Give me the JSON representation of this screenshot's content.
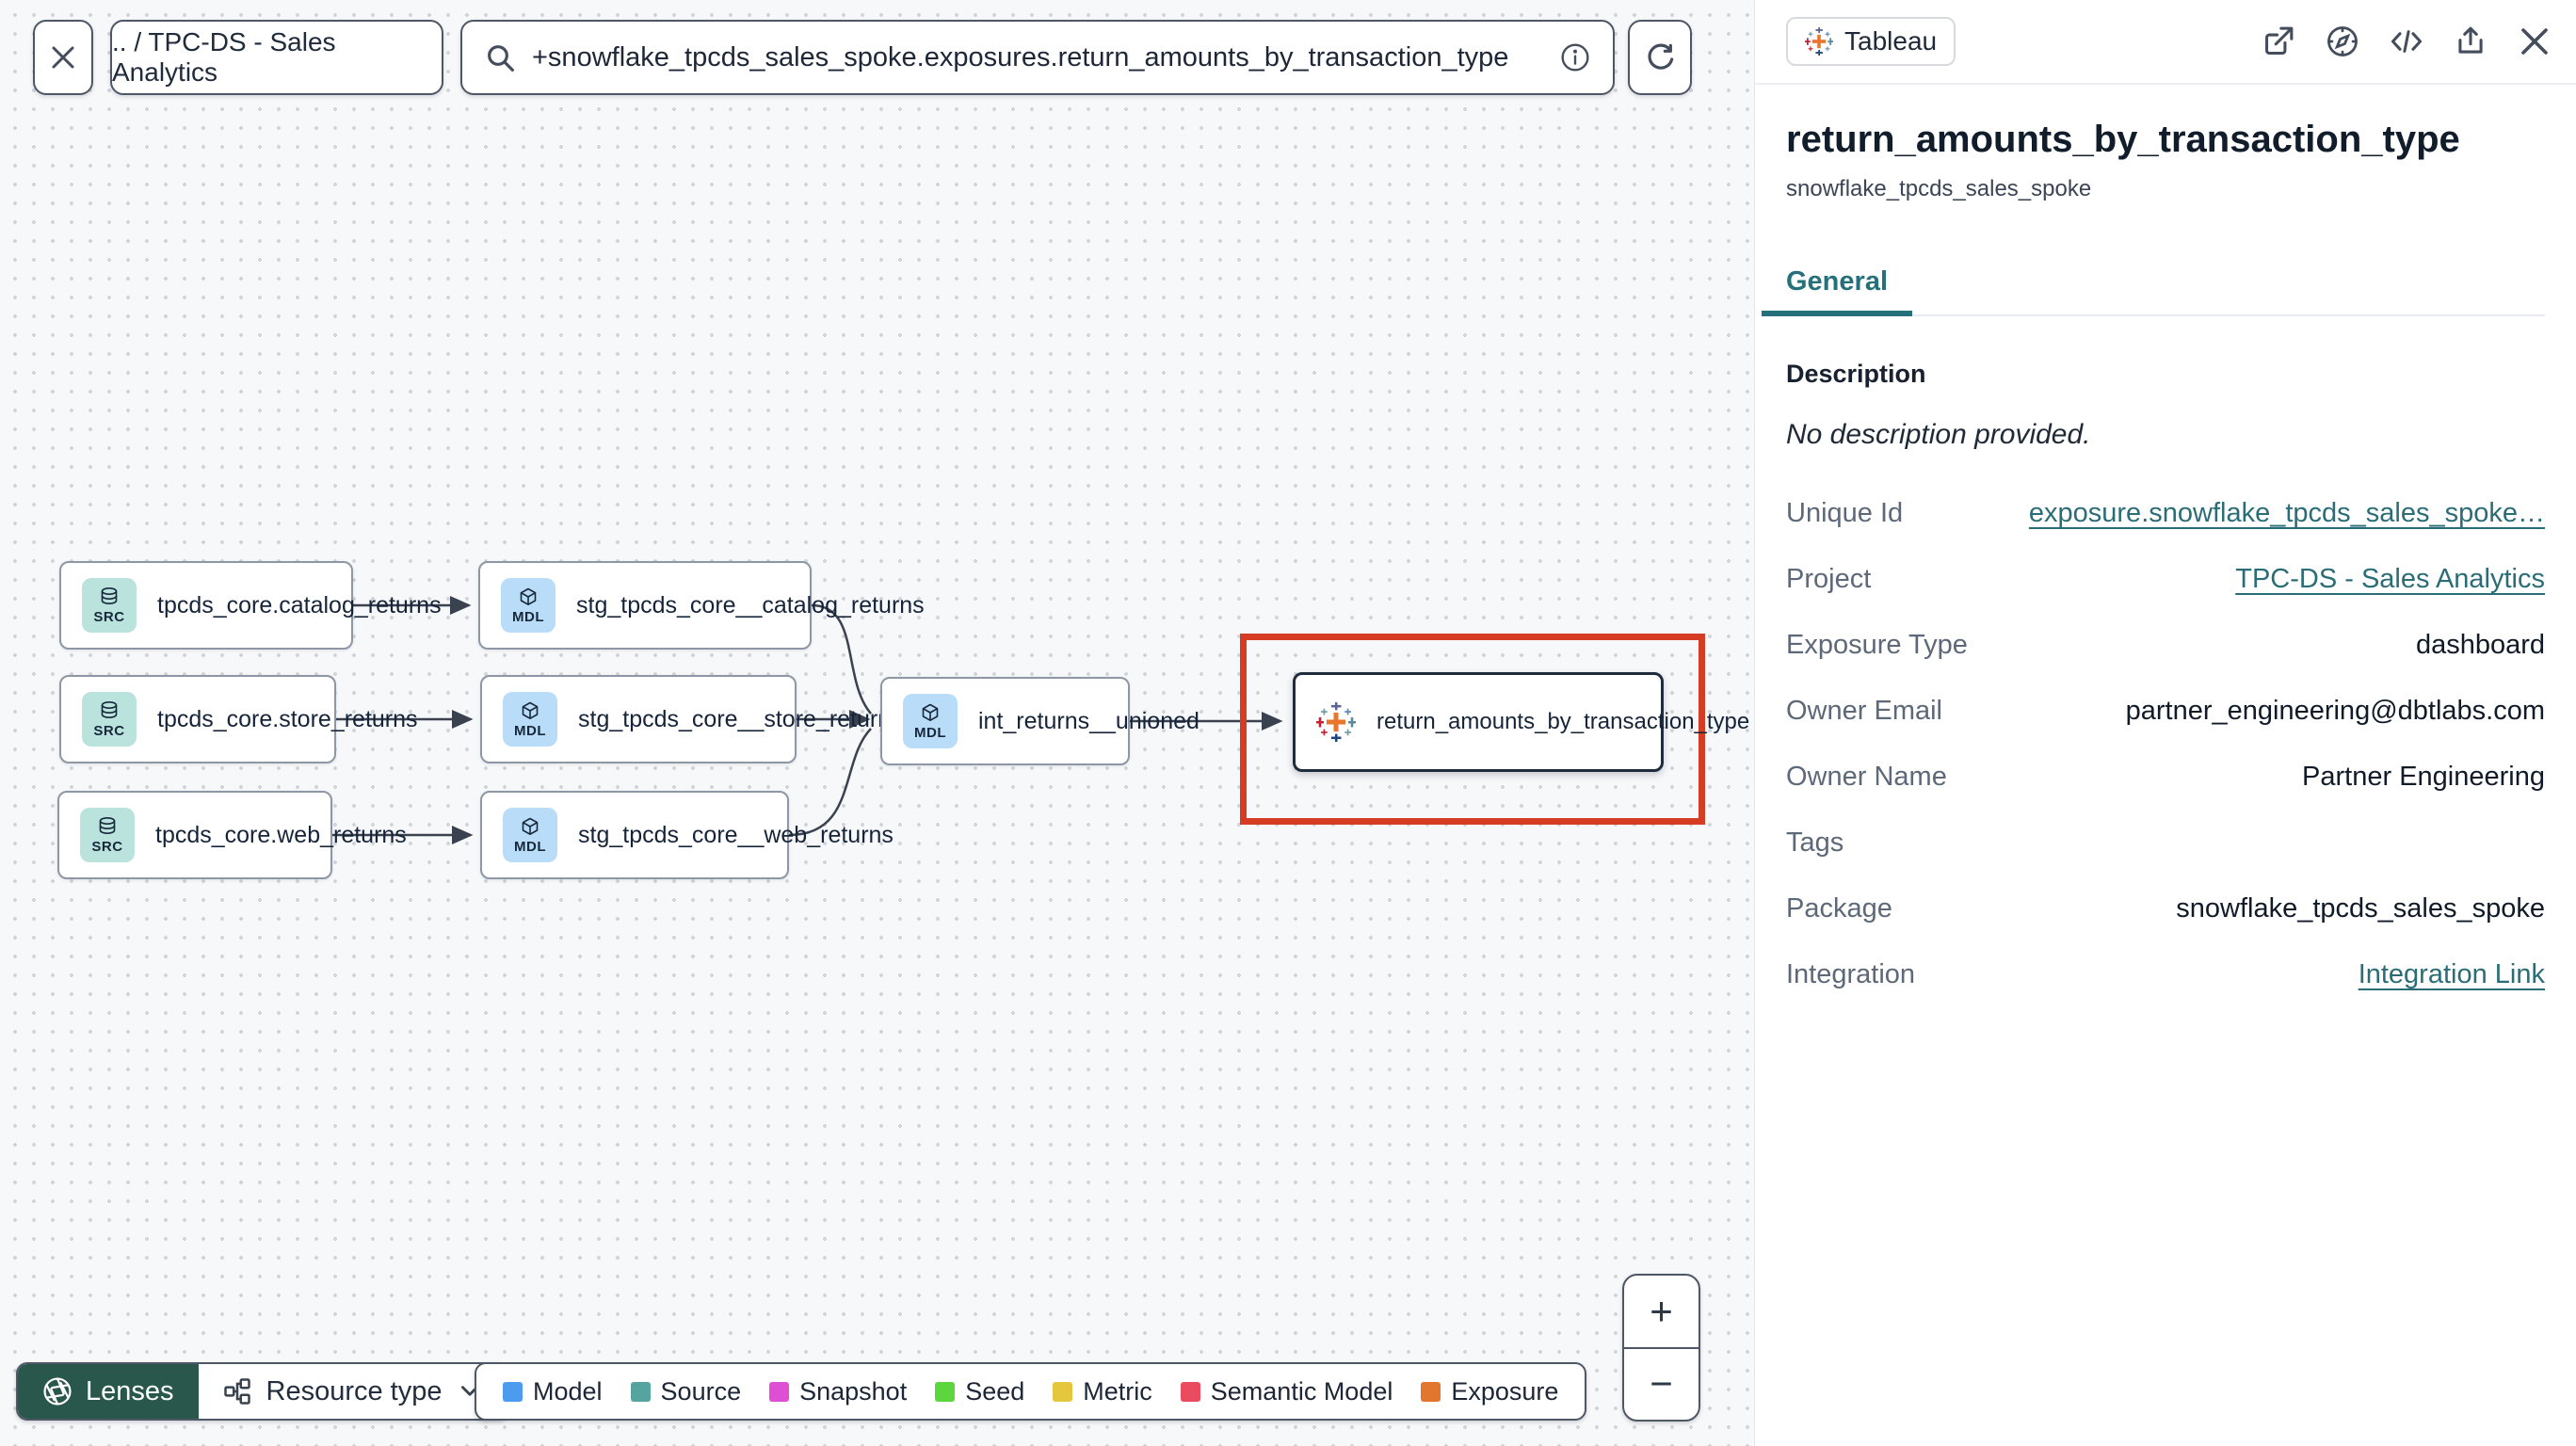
{
  "topbar": {
    "breadcrumb": ".. / TPC-DS - Sales Analytics",
    "search_value": "+snowflake_tpcds_sales_spoke.exposures.return_amounts_by_transaction_type"
  },
  "graph": {
    "nodes": [
      {
        "badge": "SRC",
        "label": "tpcds_core.catalog_returns",
        "type": "source"
      },
      {
        "badge": "SRC",
        "label": "tpcds_core.store_returns",
        "type": "source"
      },
      {
        "badge": "SRC",
        "label": "tpcds_core.web_returns",
        "type": "source"
      },
      {
        "badge": "MDL",
        "label": "stg_tpcds_core__catalog_returns",
        "type": "model"
      },
      {
        "badge": "MDL",
        "label": "stg_tpcds_core__store_returns",
        "type": "model"
      },
      {
        "badge": "MDL",
        "label": "stg_tpcds_core__web_returns",
        "type": "model"
      },
      {
        "badge": "MDL",
        "label": "int_returns__unioned",
        "type": "model"
      },
      {
        "badge": "",
        "label": "return_amounts_by_transaction_type",
        "type": "exposure"
      }
    ]
  },
  "toolbar": {
    "lenses_label": "Lenses",
    "resource_type_label": "Resource type"
  },
  "legend": {
    "items": [
      {
        "label": "Model",
        "color": "#4d9bf0"
      },
      {
        "label": "Source",
        "color": "#55a49f"
      },
      {
        "label": "Snapshot",
        "color": "#df4fd3"
      },
      {
        "label": "Seed",
        "color": "#5cd63d"
      },
      {
        "label": "Metric",
        "color": "#e5c73d"
      },
      {
        "label": "Semantic Model",
        "color": "#ea4b5f"
      },
      {
        "label": "Exposure",
        "color": "#e2762e"
      }
    ]
  },
  "zoom_controls": {
    "zoom_in": "+",
    "zoom_out": "−"
  },
  "panel": {
    "integration_badge": "Tableau",
    "title": "return_amounts_by_transaction_type",
    "subtitle": "snowflake_tpcds_sales_spoke",
    "tabs": [
      {
        "label": "General",
        "active": true
      }
    ],
    "description_heading": "Description",
    "description_empty": "No description provided.",
    "fields": [
      {
        "label": "Unique Id",
        "value": "exposure.snowflake_tpcds_sales_spoke…",
        "link": true
      },
      {
        "label": "Project",
        "value": "TPC-DS - Sales Analytics",
        "link": true
      },
      {
        "label": "Exposure Type",
        "value": "dashboard",
        "link": false
      },
      {
        "label": "Owner Email",
        "value": "partner_engineering@dbtlabs.com",
        "link": false
      },
      {
        "label": "Owner Name",
        "value": "Partner Engineering",
        "link": false
      },
      {
        "label": "Tags",
        "value": "",
        "link": false
      },
      {
        "label": "Package",
        "value": "snowflake_tpcds_sales_spoke",
        "link": false
      },
      {
        "label": "Integration",
        "value": "Integration Link",
        "link": true
      }
    ]
  },
  "colors": {
    "accent_teal": "#26707b",
    "highlight_red": "#d63c22",
    "lenses_green": "#2a574b",
    "source_badge": "#b9e3dc",
    "model_badge": "#b9dcf8"
  }
}
